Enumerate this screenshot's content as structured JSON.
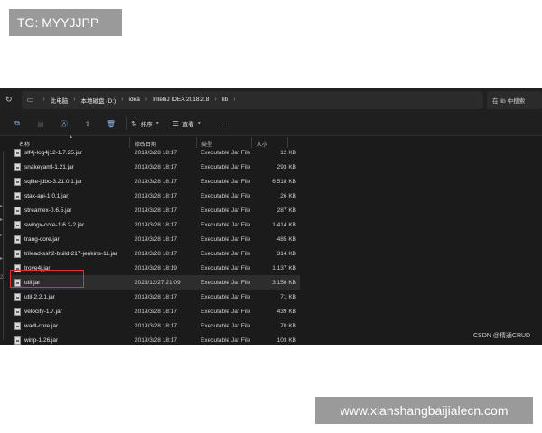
{
  "overlay": {
    "tag_text": "TG: MYYJJPP",
    "site_text": "www.xianshangbaijialecn.com",
    "watermark": "CSDN @精通CRUD"
  },
  "address_bar": {
    "crumbs": [
      "此电脑",
      "本地磁盘 (D:)",
      "idea",
      "IntelliJ IDEA 2018.2.8",
      "lib"
    ],
    "separator": "›",
    "search_placeholder": "在 lib 中搜索"
  },
  "toolbar": {
    "sort_label": "排序",
    "view_label": "查看",
    "more_label": "···"
  },
  "columns": {
    "name": "名称",
    "modified": "修改日期",
    "type": "类型",
    "size": "大小"
  },
  "files": [
    {
      "name": "slf4j-log4j12-1.7.25.jar",
      "modified": "2019/3/28 18:17",
      "type": "Executable Jar File",
      "size": "12 KB"
    },
    {
      "name": "snakeyaml-1.21.jar",
      "modified": "2019/3/28 18:17",
      "type": "Executable Jar File",
      "size": "293 KB"
    },
    {
      "name": "sqlite-jdbc-3.21.0.1.jar",
      "modified": "2019/3/28 18:17",
      "type": "Executable Jar File",
      "size": "6,518 KB"
    },
    {
      "name": "stax-api-1.0.1.jar",
      "modified": "2019/3/28 18:17",
      "type": "Executable Jar File",
      "size": "26 KB"
    },
    {
      "name": "streamex-0.6.5.jar",
      "modified": "2019/3/28 18:17",
      "type": "Executable Jar File",
      "size": "287 KB"
    },
    {
      "name": "swingx-core-1.6.2-2.jar",
      "modified": "2019/3/28 18:17",
      "type": "Executable Jar File",
      "size": "1,414 KB"
    },
    {
      "name": "trang-core.jar",
      "modified": "2019/3/28 18:17",
      "type": "Executable Jar File",
      "size": "485 KB"
    },
    {
      "name": "trilead-ssh2-build-217-jenkins-11.jar",
      "modified": "2019/3/28 18:17",
      "type": "Executable Jar File",
      "size": "314 KB"
    },
    {
      "name": "trove4j.jar",
      "modified": "2019/3/28 18:19",
      "type": "Executable Jar File",
      "size": "1,137 KB"
    },
    {
      "name": "util.jar",
      "modified": "2023/12/27 21:09",
      "type": "Executable Jar File",
      "size": "3,158 KB"
    },
    {
      "name": "util-2.2.1.jar",
      "modified": "2019/3/28 18:17",
      "type": "Executable Jar File",
      "size": "71 KB"
    },
    {
      "name": "velocity-1.7.jar",
      "modified": "2019/3/28 18:17",
      "type": "Executable Jar File",
      "size": "439 KB"
    },
    {
      "name": "wadl-core.jar",
      "modified": "2019/3/28 18:17",
      "type": "Executable Jar File",
      "size": "70 KB"
    },
    {
      "name": "winp-1.26.jar",
      "modified": "2019/3/28 18:17",
      "type": "Executable Jar File",
      "size": "103 KB"
    }
  ],
  "selected_file": "util.jar"
}
